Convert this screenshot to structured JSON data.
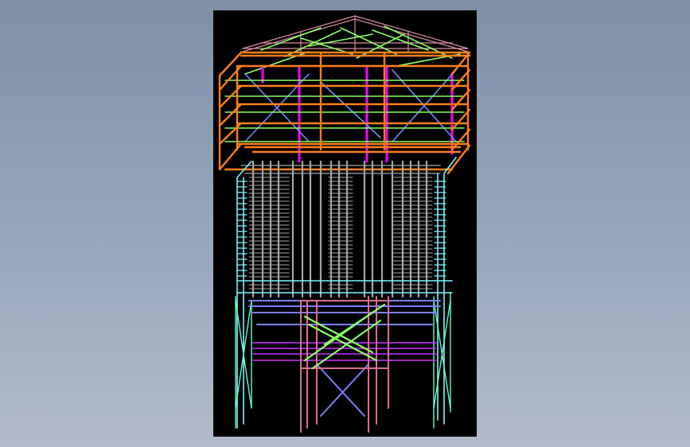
{
  "app": {
    "background_gradient": [
      "#7f8fa6",
      "#9aaabd",
      "#b3bccb"
    ],
    "viewport_background": "#000000"
  },
  "model": {
    "description_colors": {
      "roof_truss": "#d98ca0",
      "roof_bracing": "#8cff66",
      "top_frame": "#ff7f1a",
      "columns_magenta": "#ff00ff",
      "hopper_gray": "#a6a6a6",
      "lower_frame_cyan": "#7ff5ff",
      "support_pink": "#d96f8c",
      "support_blue": "#7f7fff",
      "support_green": "#8cff66",
      "purple_bracing": "#cc33ff"
    }
  }
}
